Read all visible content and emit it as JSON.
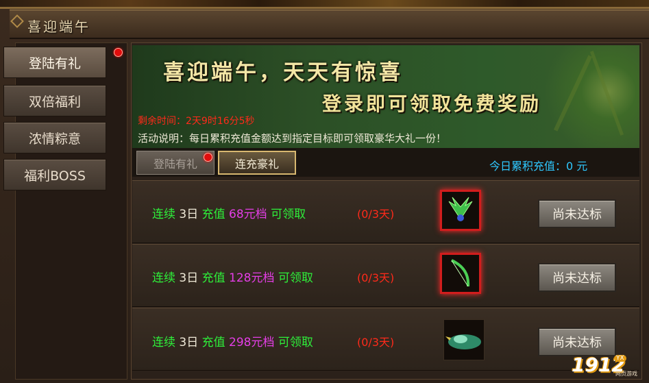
{
  "window": {
    "title": "喜迎端午"
  },
  "sidebar": {
    "items": [
      {
        "label": "登陆有礼"
      },
      {
        "label": "双倍福利"
      },
      {
        "label": "浓情粽意"
      },
      {
        "label": "福利BOSS"
      }
    ]
  },
  "banner": {
    "headline1": "喜迎端午，天天有惊喜",
    "headline2": "登录即可领取免费奖励",
    "timer": "剩余时间：2天9时16分5秒",
    "description": "活动说明：每日累积充值金额达到指定目标即可领取豪华大礼一份！"
  },
  "subtabs": [
    {
      "label": "登陆有礼"
    },
    {
      "label": "连充豪礼"
    }
  ],
  "today": {
    "label": "今日累积充值：",
    "value": "0",
    "unit": " 元"
  },
  "rows": [
    {
      "prefix": "连续 ",
      "days": "3日",
      "mid": " 充值 ",
      "tier": "68元档",
      "suffix": " 可领取",
      "progress": "(0/3天)",
      "button": "尚未达标"
    },
    {
      "prefix": "连续 ",
      "days": "3日",
      "mid": " 充值 ",
      "tier": "128元档",
      "suffix": " 可领取",
      "progress": "(0/3天)",
      "button": "尚未达标"
    },
    {
      "prefix": "连续 ",
      "days": "3日",
      "mid": " 充值 ",
      "tier": "298元档",
      "suffix": " 可领取",
      "progress": "(0/3天)",
      "button": "尚未达标"
    }
  ],
  "watermark": {
    "number": "1912",
    "badge": "YX",
    "caption": "网页游戏"
  },
  "colors": {
    "green": "#2ef03a",
    "purple": "#e43ee6",
    "red": "#ff2a1a",
    "cyan": "#2fc8ff"
  },
  "icons": [
    "notification-dot",
    "wing-item-icon",
    "bow-item-icon",
    "mount-item-icon"
  ]
}
